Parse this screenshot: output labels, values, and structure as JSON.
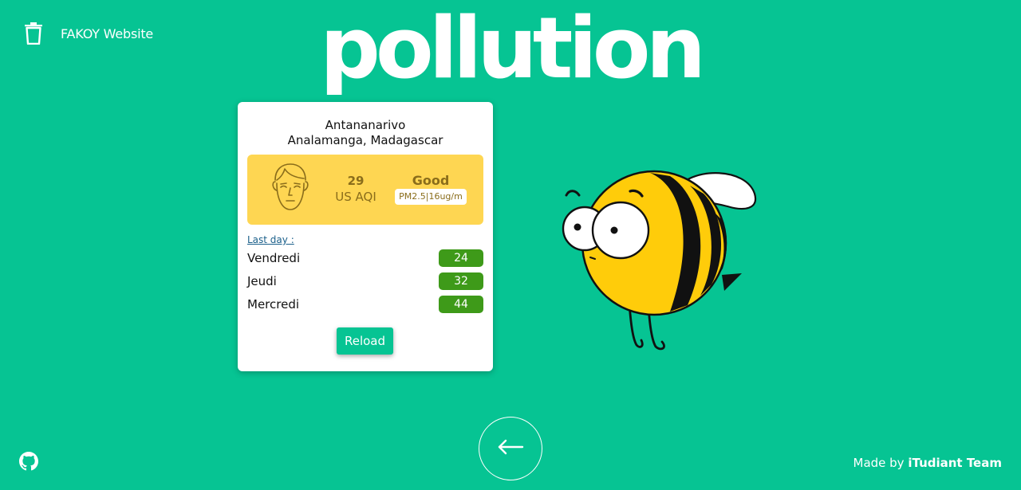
{
  "header": {
    "brand_icon": "trash-icon",
    "brand_name": "FAKOY Website",
    "title": "pollution"
  },
  "card": {
    "city": "Antananarivo",
    "region": "Analamanga, Madagascar",
    "aqi": {
      "value": "29",
      "unit": "US AQI",
      "level": "Good",
      "pollutant": "PM2.5|16ug/m",
      "face_icon": "neutral-face-icon",
      "bg_color": "#fed652",
      "text_color": "#8a6d1b"
    },
    "history_label": "Last day :",
    "history": [
      {
        "day": "Vendredi",
        "value": "24"
      },
      {
        "day": "Jeudi",
        "value": "32"
      },
      {
        "day": "Mercredi",
        "value": "44"
      }
    ],
    "badge_color": "#3e9a19",
    "reload_label": "Reload"
  },
  "mascot": "bee-illustration",
  "footer": {
    "github_icon": "github-icon",
    "back_icon": "arrow-left-icon",
    "credit_prefix": "Made by",
    "credit_team": "iTudiant Team"
  },
  "colors": {
    "background": "#06c493",
    "accent": "#06c493",
    "white": "#ffffff"
  }
}
